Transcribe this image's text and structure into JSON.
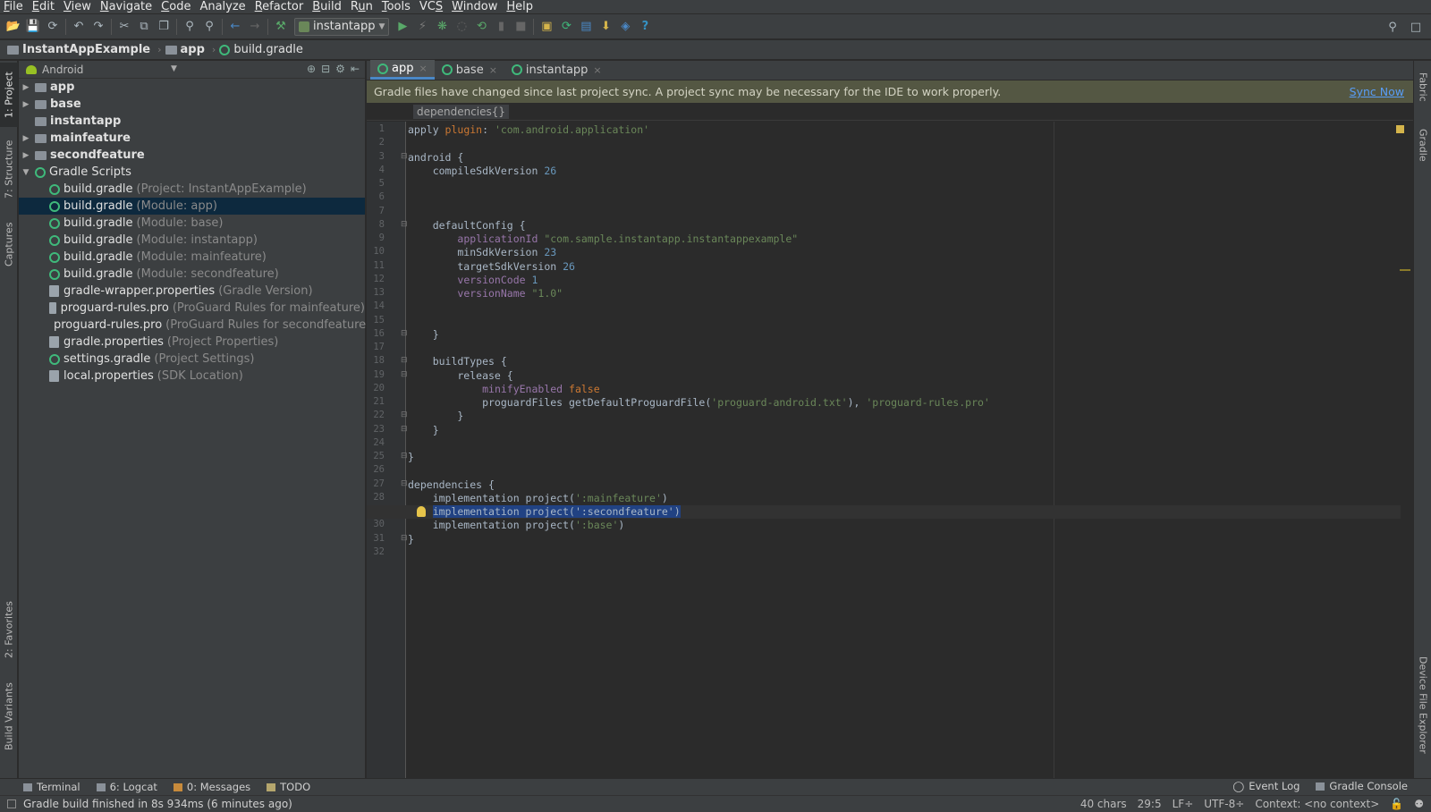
{
  "menu": [
    {
      "label": "File",
      "ul": "F"
    },
    {
      "label": "Edit",
      "ul": "E"
    },
    {
      "label": "View",
      "ul": "V"
    },
    {
      "label": "Navigate",
      "ul": "N"
    },
    {
      "label": "Code",
      "ul": "C"
    },
    {
      "label": "Analyze",
      "ul": ""
    },
    {
      "label": "Refactor",
      "ul": "R"
    },
    {
      "label": "Build",
      "ul": "B"
    },
    {
      "label": "Run",
      "ul": "u"
    },
    {
      "label": "Tools",
      "ul": "T"
    },
    {
      "label": "VCS",
      "ul": "S"
    },
    {
      "label": "Window",
      "ul": "W"
    },
    {
      "label": "Help",
      "ul": "H"
    }
  ],
  "toolbar": {
    "run_config": "instantapp",
    "help_glyph": "?",
    "colors": {
      "run": "#59a869",
      "debug": "#59a869",
      "help": "#3592c4"
    }
  },
  "breadcrumb": {
    "project": "InstantAppExample",
    "module": "app",
    "file": "build.gradle"
  },
  "left_tabs": {
    "project": "1: Project",
    "structure": "7: Structure",
    "captures": "Captures",
    "favorites": "2: Favorites",
    "build_variants": "Build Variants"
  },
  "right_tabs": {
    "fabric": "Fabric",
    "gradle": "Gradle",
    "device_file_explorer": "Device File Explorer"
  },
  "project_panel": {
    "view": "Android",
    "tree": [
      {
        "label": "app",
        "hint": "",
        "kind": "folder",
        "level": 0,
        "arrow": "▶",
        "bold": true
      },
      {
        "label": "base",
        "hint": "",
        "kind": "folder",
        "level": 0,
        "arrow": "▶",
        "bold": true
      },
      {
        "label": "instantapp",
        "hint": "",
        "kind": "folder",
        "level": 0,
        "arrow": "",
        "bold": true
      },
      {
        "label": "mainfeature",
        "hint": "",
        "kind": "folder",
        "level": 0,
        "arrow": "▶",
        "bold": true
      },
      {
        "label": "secondfeature",
        "hint": "",
        "kind": "folder",
        "level": 0,
        "arrow": "▶",
        "bold": true
      },
      {
        "label": "Gradle Scripts",
        "hint": "",
        "kind": "gradle",
        "level": 0,
        "arrow": "▼",
        "bold": false
      },
      {
        "label": "build.gradle",
        "hint": "(Project: InstantAppExample)",
        "kind": "gradle",
        "level": 1,
        "arrow": "",
        "bold": false
      },
      {
        "label": "build.gradle",
        "hint": "(Module: app)",
        "kind": "gradle",
        "level": 1,
        "arrow": "",
        "bold": false,
        "selected": true
      },
      {
        "label": "build.gradle",
        "hint": "(Module: base)",
        "kind": "gradle",
        "level": 1,
        "arrow": "",
        "bold": false
      },
      {
        "label": "build.gradle",
        "hint": "(Module: instantapp)",
        "kind": "gradle",
        "level": 1,
        "arrow": "",
        "bold": false
      },
      {
        "label": "build.gradle",
        "hint": "(Module: mainfeature)",
        "kind": "gradle",
        "level": 1,
        "arrow": "",
        "bold": false
      },
      {
        "label": "build.gradle",
        "hint": "(Module: secondfeature)",
        "kind": "gradle",
        "level": 1,
        "arrow": "",
        "bold": false
      },
      {
        "label": "gradle-wrapper.properties",
        "hint": "(Gradle Version)",
        "kind": "file",
        "level": 1,
        "arrow": "",
        "bold": false
      },
      {
        "label": "proguard-rules.pro",
        "hint": "(ProGuard Rules for mainfeature)",
        "kind": "file",
        "level": 1,
        "arrow": "",
        "bold": false
      },
      {
        "label": "proguard-rules.pro",
        "hint": "(ProGuard Rules for secondfeature)",
        "kind": "file",
        "level": 1,
        "arrow": "",
        "bold": false
      },
      {
        "label": "gradle.properties",
        "hint": "(Project Properties)",
        "kind": "file",
        "level": 1,
        "arrow": "",
        "bold": false
      },
      {
        "label": "settings.gradle",
        "hint": "(Project Settings)",
        "kind": "gradle",
        "level": 1,
        "arrow": "",
        "bold": false
      },
      {
        "label": "local.properties",
        "hint": "(SDK Location)",
        "kind": "file",
        "level": 1,
        "arrow": "",
        "bold": false
      }
    ]
  },
  "editor": {
    "tabs": [
      {
        "label": "app",
        "active": true
      },
      {
        "label": "base",
        "active": false
      },
      {
        "label": "instantapp",
        "active": false
      }
    ],
    "banner": "Gradle files have changed since last project sync. A project sync may be necessary for the IDE to work properly.",
    "sync_now": "Sync Now",
    "structure_crumb": "dependencies{}",
    "caret_line": 29,
    "lines": [
      [
        [
          "t",
          "apply "
        ],
        [
          "kw",
          "plugin"
        ],
        [
          "t",
          ": "
        ],
        [
          "str",
          "'com.android.application'"
        ]
      ],
      [],
      [
        [
          "t",
          "android {"
        ]
      ],
      [
        [
          "t",
          "    compileSdkVersion "
        ],
        [
          "num",
          "26"
        ]
      ],
      [],
      [],
      [],
      [
        [
          "t",
          "    defaultConfig {"
        ]
      ],
      [
        [
          "t",
          "        "
        ],
        [
          "prop",
          "applicationId "
        ],
        [
          "str",
          "\"com.sample.instantapp.instantappexample\""
        ]
      ],
      [
        [
          "t",
          "        minSdkVersion "
        ],
        [
          "num",
          "23"
        ]
      ],
      [
        [
          "t",
          "        targetSdkVersion "
        ],
        [
          "num",
          "26"
        ]
      ],
      [
        [
          "t",
          "        "
        ],
        [
          "prop",
          "versionCode "
        ],
        [
          "num",
          "1"
        ]
      ],
      [
        [
          "t",
          "        "
        ],
        [
          "prop",
          "versionName "
        ],
        [
          "str",
          "\"1.0\""
        ]
      ],
      [],
      [],
      [
        [
          "t",
          "    }"
        ]
      ],
      [],
      [
        [
          "t",
          "    buildTypes {"
        ]
      ],
      [
        [
          "t",
          "        release {"
        ]
      ],
      [
        [
          "t",
          "            "
        ],
        [
          "prop",
          "minifyEnabled "
        ],
        [
          "kw",
          "false"
        ]
      ],
      [
        [
          "t",
          "            proguardFiles getDefaultProguardFile("
        ],
        [
          "str",
          "'proguard-android.txt'"
        ],
        [
          "t",
          "), "
        ],
        [
          "str",
          "'proguard-rules.pro'"
        ]
      ],
      [
        [
          "t",
          "        }"
        ]
      ],
      [
        [
          "t",
          "    }"
        ]
      ],
      [],
      [
        [
          "t",
          "}"
        ]
      ],
      [],
      [
        [
          "t",
          "dependencies {"
        ]
      ],
      [
        [
          "t",
          "    implementation project("
        ],
        [
          "str",
          "':mainfeature'"
        ],
        [
          "t",
          ")"
        ]
      ],
      [
        [
          "t",
          "    "
        ],
        [
          "sel",
          "implementation project(':secondfeature')"
        ]
      ],
      [
        [
          "t",
          "    implementation project("
        ],
        [
          "str",
          "':base'"
        ],
        [
          "t",
          ")"
        ]
      ],
      [
        [
          "t",
          "}"
        ]
      ],
      []
    ],
    "folds": [
      3,
      8,
      16,
      18,
      19,
      22,
      23,
      25,
      27,
      31
    ]
  },
  "bottom_tools": {
    "terminal": "Terminal",
    "logcat": "6: Logcat",
    "messages": "0: Messages",
    "todo": "TODO",
    "event_log": "Event Log",
    "gradle_console": "Gradle Console"
  },
  "status": {
    "message": "Gradle build finished in 8s 934ms (6 minutes ago)",
    "chars": "40 chars",
    "position": "29:5",
    "line_sep": "LF÷",
    "encoding": "UTF-8÷",
    "context": "Context: <no context>"
  }
}
